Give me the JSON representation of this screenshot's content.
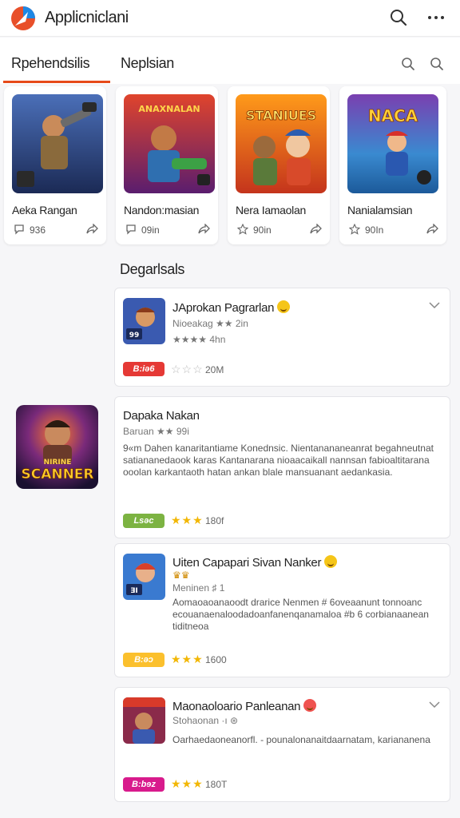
{
  "app": {
    "title": "Applicniclani"
  },
  "tabs": [
    {
      "label": "Rpehendsilis",
      "active": true
    },
    {
      "label": "Neplsian",
      "active": false
    }
  ],
  "cards": [
    {
      "title": "Aeka Rangan",
      "count": "936",
      "meta_icon": "comment-icon",
      "art_text": ""
    },
    {
      "title": "Nandon:masian",
      "count": "09in",
      "meta_icon": "comment-icon",
      "art_text": "ANAXNALAN"
    },
    {
      "title": "Nera Iamaolan",
      "count": "90in",
      "meta_icon": "star-outline-icon",
      "art_text": "STANIUES"
    },
    {
      "title": "Nanialamsian",
      "count": "90In",
      "meta_icon": "star-outline-icon",
      "art_text": "NACA"
    }
  ],
  "section": {
    "title": "Degarlsals"
  },
  "side_art": {
    "text_top": "NIRINE",
    "text_bottom": "SCANNER"
  },
  "list": [
    {
      "name": "JAprokan Pagrarlan",
      "emoji": true,
      "sub1": "Nioeakag ★★ 2in",
      "sub2": "★★★★ 4hn",
      "desc": "",
      "badge": "B:iǝ6",
      "badge_color": "#e53935",
      "stars": "☆☆☆",
      "star_color": "#bbbbbb",
      "count": "20M",
      "thumb_label": "99",
      "chevron": true
    },
    {
      "name": "Dapaka Nakan",
      "emoji": false,
      "sub1": "Baruan ★★ 99i",
      "sub2": "",
      "desc": "9«m Dahen kanaritantiame Konednsic. Nientanananeanrat begahneutnat satiananedaook karas Kantanarana nioaacaikall nannsan fabioaltitarana ooolan karkantaoth hatan ankan blale mansuanant aedankasia.",
      "badge": "Lsǝc",
      "badge_color": "#7cb342",
      "stars": "★★★",
      "star_color": "#f2b705",
      "count": "180f",
      "thumb_label": "",
      "chevron": false
    },
    {
      "name": "Uiten Capapari Sivan Nanker",
      "emoji": true,
      "sub1": "♛♛",
      "sub2": "Meninen ♯ 1",
      "desc": "Aomaoaoanaoodt drarice Nenmen # 6oveaanunt tonnoanc ecouanaenaloodadoanfanenqanamaloa #b 6 corbianaanean tiditneoa",
      "badge": "B:ǝɔ",
      "badge_color": "#fbc02d",
      "stars": "★★★",
      "star_color": "#f2b705",
      "count": "1600",
      "thumb_label": "ƎI",
      "chevron": false
    },
    {
      "name": "Maonaoloario Panleanan",
      "emoji": true,
      "sub1": "Stohaonan ·ı ⊛",
      "sub2": "",
      "desc": "Oarhaedaoneanorfl. - pounalonanaitdaarnatam, kariananena",
      "badge": "B:bɘz",
      "badge_color": "#d81b8c",
      "stars": "★★★",
      "star_color": "#f2b705",
      "count": "180T",
      "thumb_label": "",
      "chevron": true
    }
  ]
}
